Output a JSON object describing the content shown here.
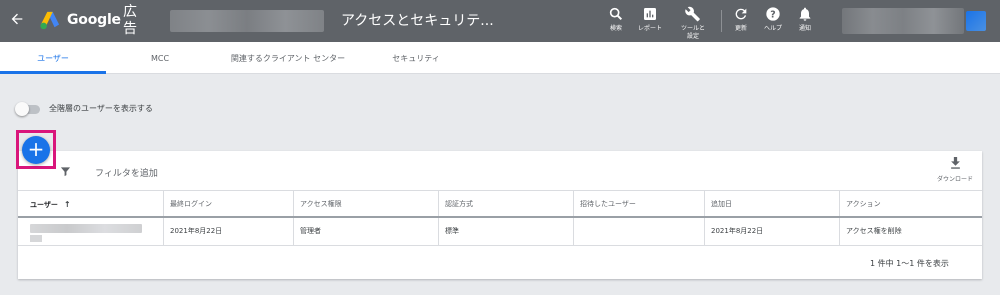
{
  "header": {
    "brand": "Google",
    "brand_suffix": "広告",
    "page_title": "アクセスとセキュリテ...",
    "tools": [
      {
        "icon": "search-icon",
        "label": "検索"
      },
      {
        "icon": "bar-chart-icon",
        "label": "レポート"
      },
      {
        "icon": "wrench-icon",
        "label": "ツールと設定"
      },
      {
        "icon": "refresh-icon",
        "label": "更新"
      },
      {
        "icon": "help-icon",
        "label": "ヘルプ"
      },
      {
        "icon": "bell-icon",
        "label": "通知"
      }
    ]
  },
  "tabs": [
    {
      "label": "ユーザー",
      "active": true
    },
    {
      "label": "MCC",
      "active": false
    },
    {
      "label": "関連するクライアント センター",
      "active": false
    },
    {
      "label": "セキュリティ",
      "active": false
    }
  ],
  "toggle": {
    "label": "全階層のユーザーを表示する",
    "on": false
  },
  "toolbar": {
    "add_button": "+",
    "filter_label": "フィルタを追加",
    "download_label": "ダウンロード"
  },
  "table": {
    "columns": [
      "ユーザー",
      "最終ログイン",
      "アクセス権限",
      "認証方式",
      "招待したユーザー",
      "追加日",
      "アクション"
    ],
    "rows": [
      {
        "user": "",
        "last_login": "2021年8月22日",
        "access": "管理者",
        "auth": "標準",
        "invited_by": "",
        "added": "2021年8月22日",
        "action": "アクセス権を削除"
      }
    ]
  },
  "pager": {
    "text": "1 件中 1～1 件を表示"
  },
  "colors": {
    "accent": "#1a73e8",
    "appbar": "#5f6368",
    "highlight": "#d9167b"
  }
}
